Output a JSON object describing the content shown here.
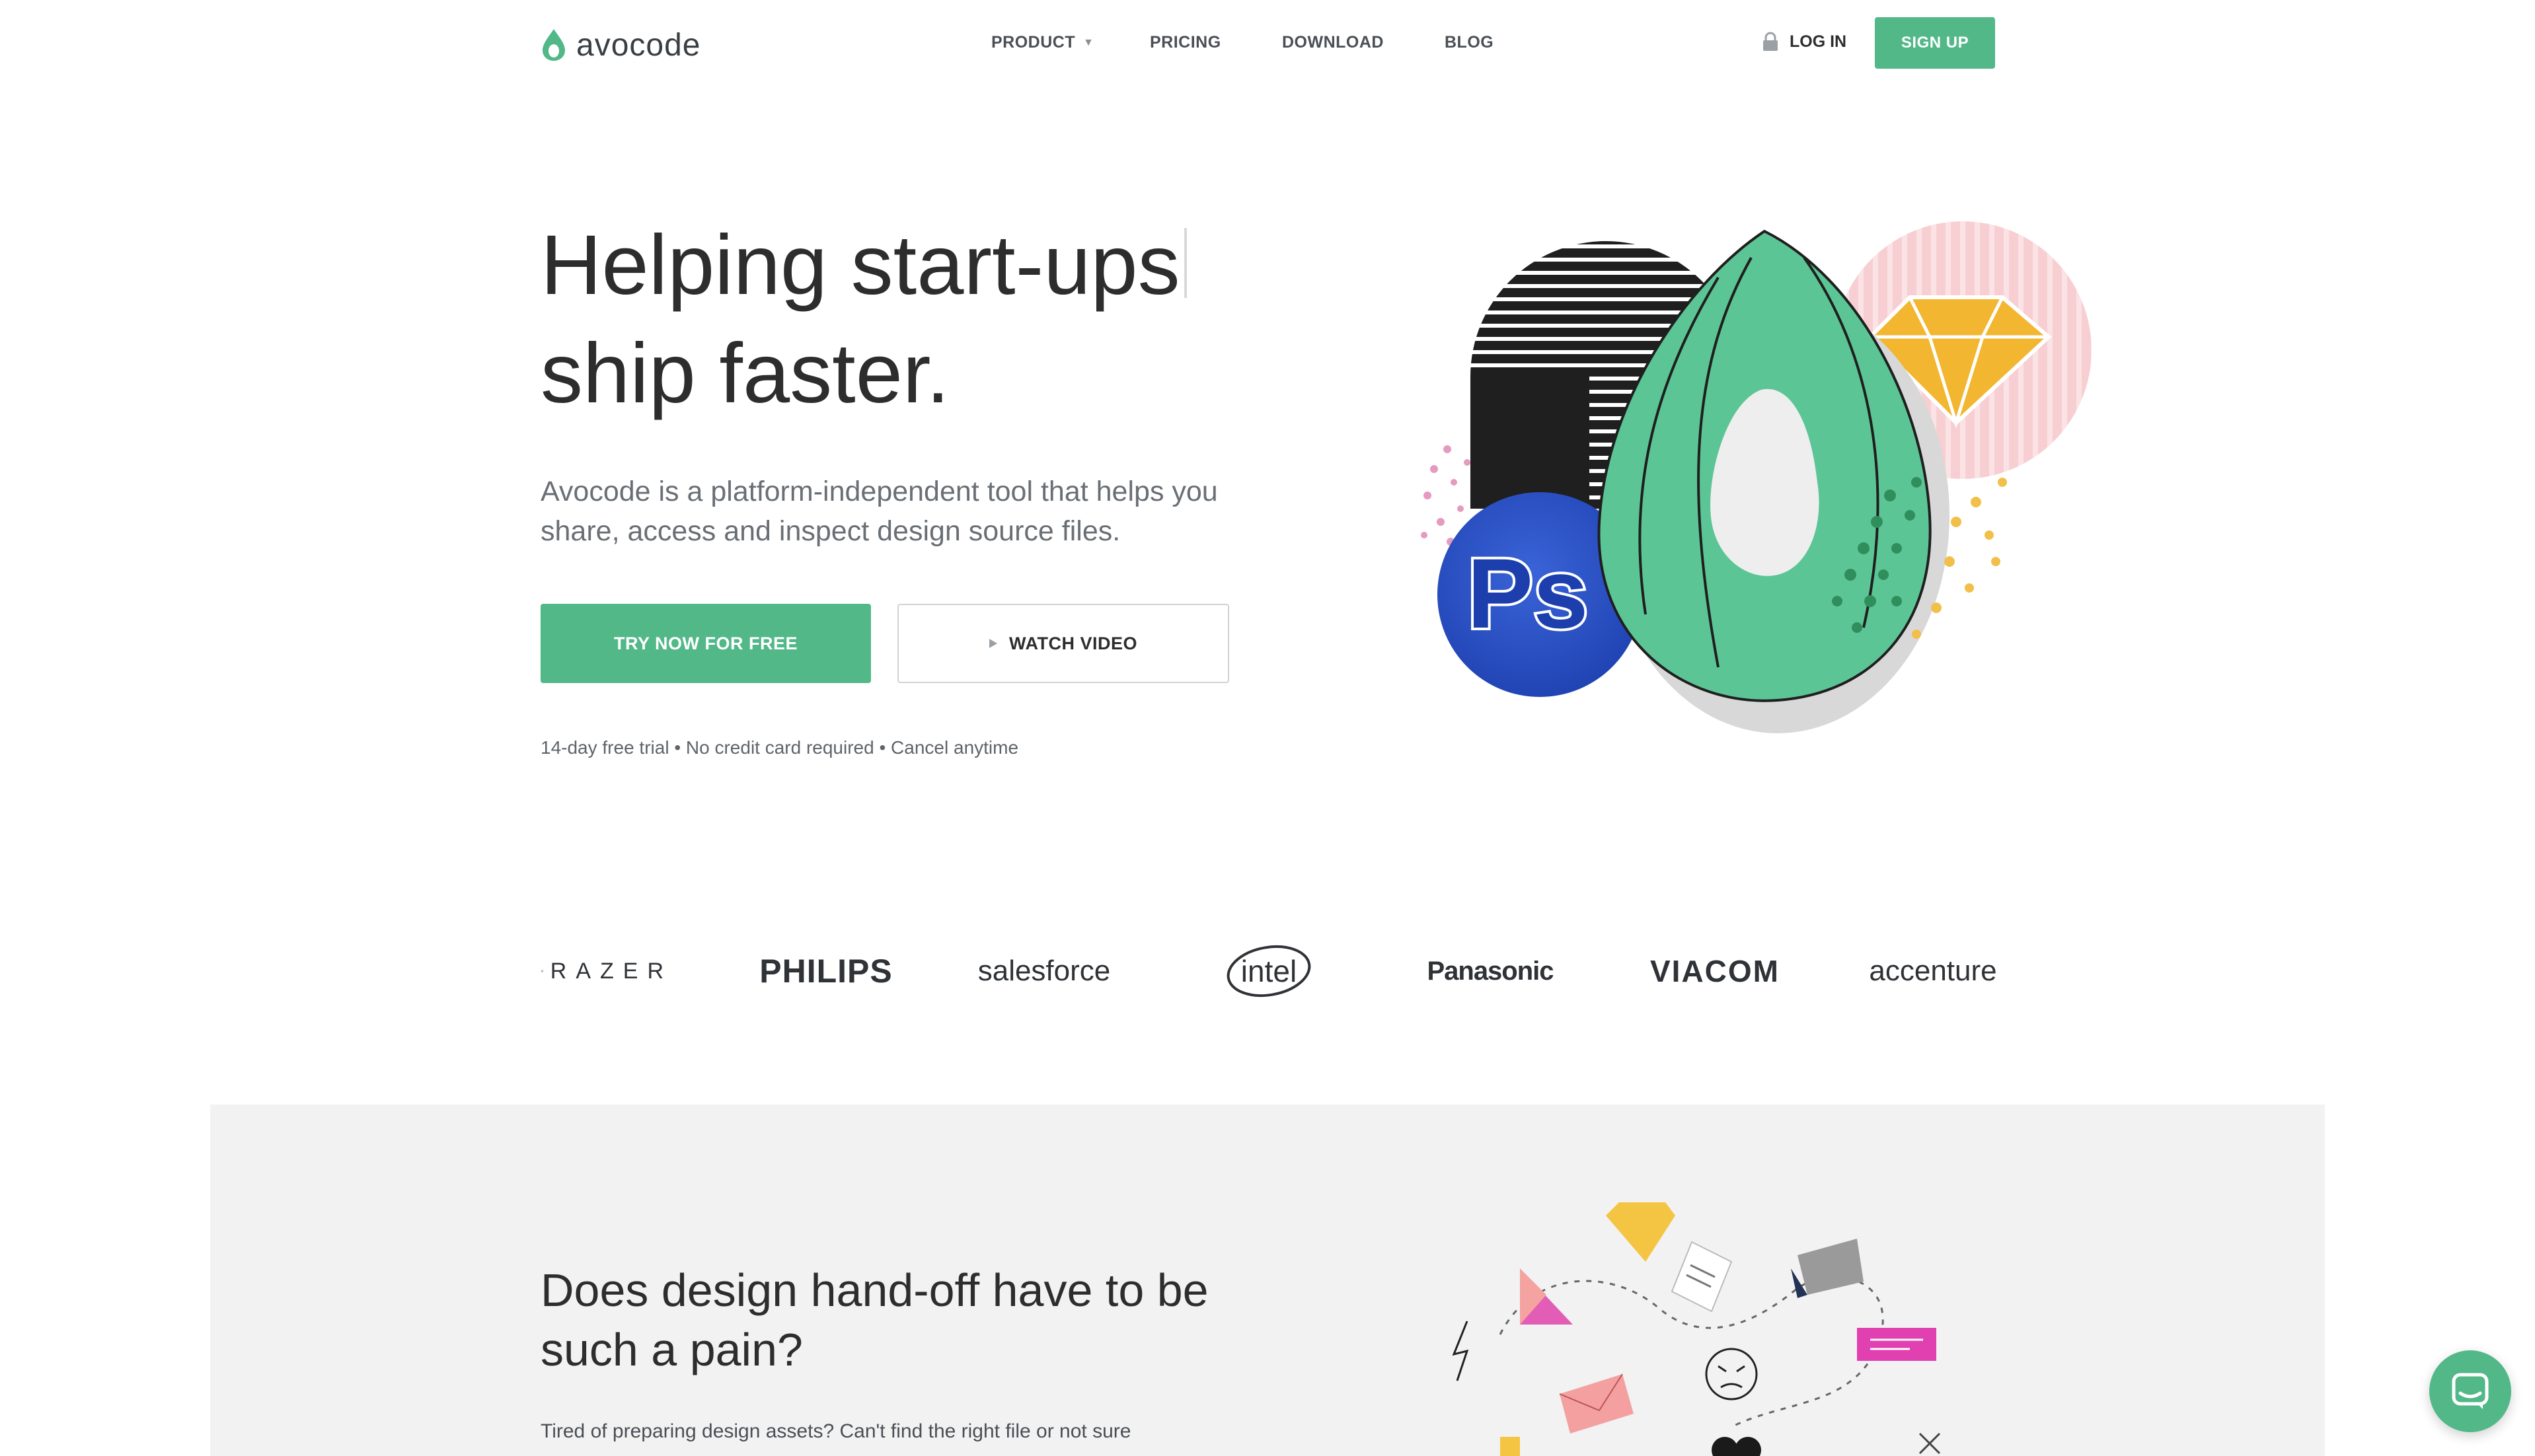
{
  "nav": {
    "logo_text": "avocode",
    "links": [
      {
        "label": "PRODUCT",
        "has_dropdown": true
      },
      {
        "label": "PRICING"
      },
      {
        "label": "DOWNLOAD"
      },
      {
        "label": "BLOG"
      }
    ],
    "login_label": "LOG IN",
    "signup_label": "SIGN UP"
  },
  "hero": {
    "title_line1": "Helping start-ups",
    "title_line2": "ship faster.",
    "subtitle": "Avocode is a platform-independent tool that helps you share, access and inspect design source files.",
    "primary_cta": "TRY NOW FOR FREE",
    "secondary_cta": "WATCH VIDEO",
    "trial_note": "14-day free trial • No credit card required • Cancel anytime",
    "illustration_badge": "Ps"
  },
  "clients": [
    "RAZER",
    "PHILIPS",
    "salesforce",
    "intel",
    "Panasonic",
    "VIACOM",
    "accenture"
  ],
  "section2": {
    "title": "Does design hand-off have to be such a pain?",
    "body": "Tired of preparing design assets? Can't find the right file or not sure"
  },
  "colors": {
    "brand_green": "#52b888",
    "text_dark": "#2d2d2d",
    "text_muted": "#6a6f75",
    "section_bg": "#f2f2f2"
  },
  "icons": {
    "logo": "avocado-drop-icon",
    "login": "lock-icon",
    "video": "play-icon",
    "chat": "chat-bubble-icon"
  }
}
